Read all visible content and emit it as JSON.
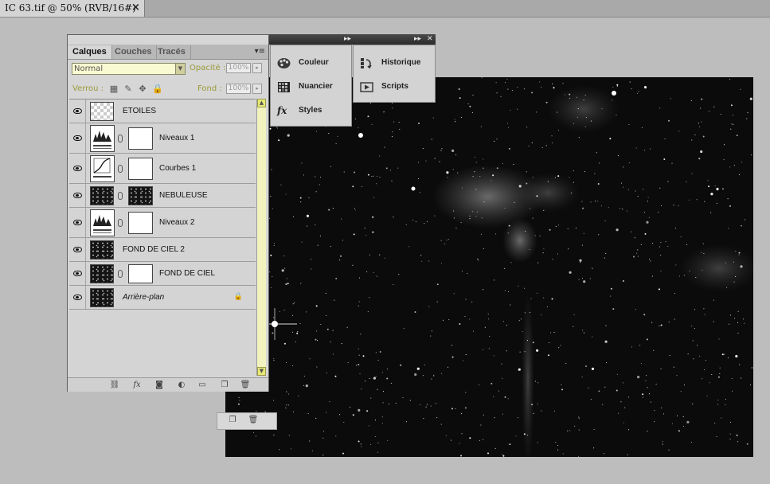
{
  "document_tab": {
    "title": "IC 63.tif @ 50% (RVB/16#)",
    "close_glyph": "×"
  },
  "panel_strip": {
    "collapse_left": "◂◂",
    "expand": "▸▸",
    "expand2": "▸▸",
    "close": "✕"
  },
  "layers_panel": {
    "tabs": [
      {
        "label": "Calques",
        "active": true
      },
      {
        "label": "Couches",
        "active": false
      },
      {
        "label": "Tracés",
        "active": false
      }
    ],
    "menu_icon": "panel-menu-icon",
    "blend_mode": "Normal",
    "opacity_label": "Opacité :",
    "opacity_value": "100%",
    "lock_label": "Verrou :",
    "fill_label": "Fond :",
    "fill_value": "100%",
    "layers": [
      {
        "name": "ETOILES",
        "thumb": "transparent",
        "mask": null,
        "italic": false,
        "locked": false
      },
      {
        "name": "Niveaux 1",
        "thumb": "levels",
        "mask": "white",
        "italic": false,
        "locked": false
      },
      {
        "name": "Courbes 1",
        "thumb": "curves",
        "mask": "white",
        "italic": false,
        "locked": false
      },
      {
        "name": "NEBULEUSE",
        "thumb": "stars",
        "mask": "stars",
        "italic": false,
        "locked": false
      },
      {
        "name": "Niveaux 2",
        "thumb": "levels",
        "mask": "white",
        "italic": false,
        "locked": false
      },
      {
        "name": "FOND DE CIEL 2",
        "thumb": "stars",
        "mask": null,
        "italic": false,
        "locked": false
      },
      {
        "name": "FOND DE CIEL",
        "thumb": "stars",
        "mask": "white",
        "italic": false,
        "locked": false
      },
      {
        "name": "Arrière-plan",
        "thumb": "stars",
        "mask": null,
        "italic": true,
        "locked": true
      }
    ],
    "bottom_icons": [
      "link-icon",
      "fx-icon",
      "mask-icon",
      "adjustment-icon",
      "group-folder-icon",
      "new-layer-icon",
      "trash-icon"
    ]
  },
  "dock_panels": {
    "col1": [
      {
        "label": "Couleur",
        "icon": "palette-icon"
      },
      {
        "label": "Nuancier",
        "icon": "swatches-icon"
      },
      {
        "label": "Styles",
        "icon": "fx-styles-icon"
      }
    ],
    "col2": [
      {
        "label": "Historique",
        "icon": "history-icon"
      },
      {
        "label": "Scripts",
        "icon": "play-icon"
      }
    ]
  },
  "colors": {
    "app_bg": "#bdbdbd",
    "panel_bg": "#d6d6d6",
    "field_yellow": "#fafad2",
    "canvas": "#0b0b0b",
    "label_olive": "#9a9a3a"
  }
}
